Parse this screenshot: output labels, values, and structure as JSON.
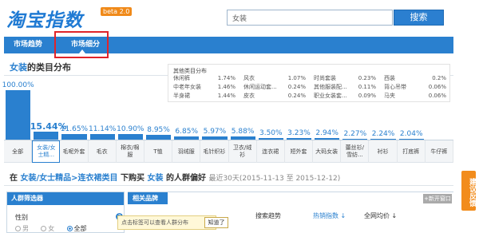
{
  "header": {
    "logo": "淘宝指数",
    "beta": "beta 2.0",
    "search_value": "女装",
    "search_button": "搜索"
  },
  "nav": {
    "tabs": [
      {
        "label": "市场趋势"
      },
      {
        "label": "市场细分"
      }
    ]
  },
  "section": {
    "keyword": "女装",
    "title_suffix": "的类目分布"
  },
  "legend": {
    "title": "其他类目分布",
    "items": [
      {
        "name": "休闲裤",
        "pct": "1.74%"
      },
      {
        "name": "中老年女装",
        "pct": "1.46%"
      },
      {
        "name": "半身裙",
        "pct": "1.44%"
      },
      {
        "name": "风衣",
        "pct": "1.07%"
      },
      {
        "name": "休闲运动套...",
        "pct": "0.24%"
      },
      {
        "name": "皮衣",
        "pct": "0.24%"
      },
      {
        "name": "时尚套装",
        "pct": "0.23%"
      },
      {
        "name": "其他服装配...",
        "pct": "0.11%"
      },
      {
        "name": "职业女装套...",
        "pct": "0.09%"
      },
      {
        "name": "西装",
        "pct": "0.2%"
      },
      {
        "name": "背心吊带",
        "pct": "0.06%"
      },
      {
        "name": "马夹",
        "pct": "0.06%"
      }
    ]
  },
  "chart_data": {
    "type": "bar",
    "categories": [
      "全部",
      "女装/女士精...",
      "毛呢外套",
      "毛衣",
      "棉衣/棉服",
      "T恤",
      "羽绒服",
      "毛针织衫",
      "卫衣/绒衫",
      "连衣裙",
      "短外套",
      "大码女装",
      "蕾丝衫/雪纺...",
      "衬衫",
      "打底裤",
      "牛仔裤"
    ],
    "values": [
      100.0,
      15.44,
      11.65,
      11.14,
      10.9,
      8.95,
      6.85,
      5.97,
      5.88,
      3.5,
      3.23,
      2.94,
      2.27,
      2.24,
      2.04
    ],
    "value_labels": [
      "100.00%",
      "15.44%",
      "11.65%",
      "11.14%",
      "10.90%",
      "8.95%",
      "6.85%",
      "5.97%",
      "5.88%",
      "3.50%",
      "3.23%",
      "2.94%",
      "2.27%",
      "2.24%",
      "2.04%"
    ],
    "ylim": [
      0,
      100
    ]
  },
  "crumb": {
    "prefix": "在",
    "path": "女装/女士精品>连衣裙类目",
    "middle": "下购买",
    "keyword": "女装",
    "suffix": "的人群偏好",
    "meta": "最近30天(2015-11-13 至 2015-12-12)"
  },
  "filter": {
    "title": "人群筛选器",
    "gender_label": "性别",
    "help": "?",
    "options": [
      {
        "label": "男"
      },
      {
        "label": "女"
      },
      {
        "label": "全部"
      }
    ]
  },
  "related": {
    "tab": "相关品牌",
    "add_compare": "+新开窗口",
    "columns": [
      {
        "label": "搜索趋势"
      },
      {
        "label": "热销指数 ↓"
      },
      {
        "label": "全网均价 ↓"
      }
    ]
  },
  "tooltip": {
    "text": "点击标签可以查看人群分布",
    "button": "知道了"
  },
  "feedback": "建议反馈"
}
